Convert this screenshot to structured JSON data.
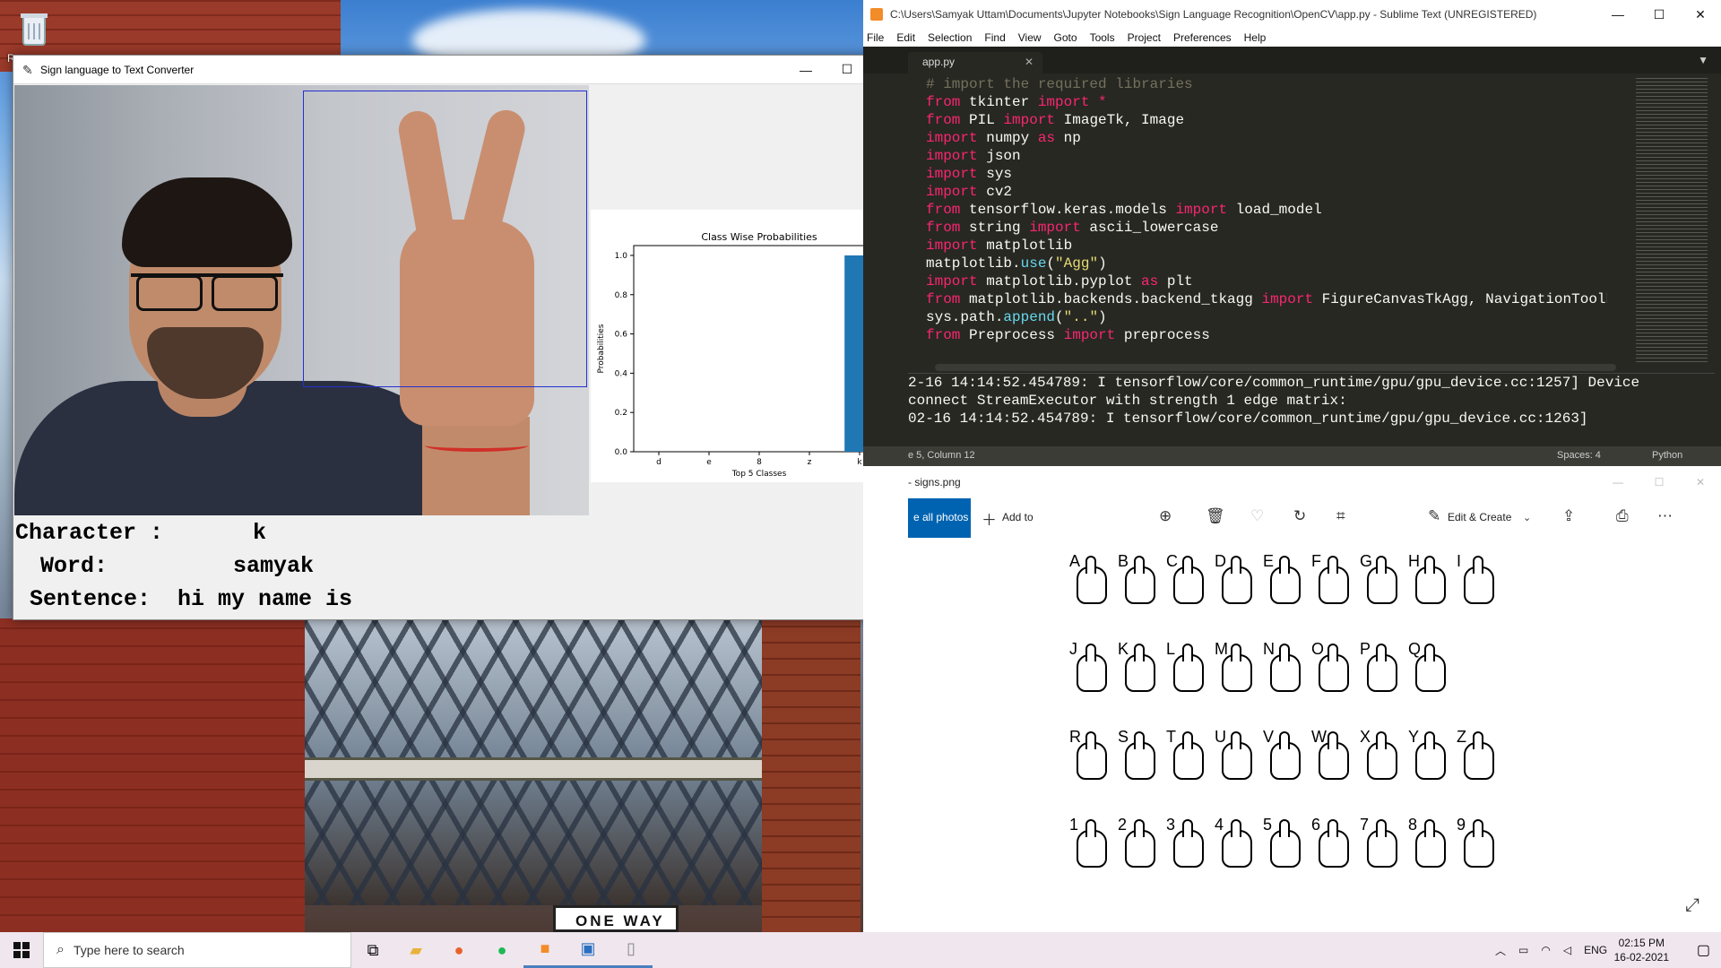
{
  "desktop": {
    "recycle_bin_label": "R",
    "street_sign_text": "ONE WAY"
  },
  "tk_window": {
    "title": "Sign language to Text Converter",
    "minimize": "—",
    "maximize": "☐",
    "close": "✕",
    "character_label": "Character :",
    "character_value": "k",
    "word_label": "Word:",
    "word_value": "samyak",
    "sentence_label": "Sentence:",
    "sentence_value": "hi my name is"
  },
  "chart_data": {
    "type": "bar",
    "title": "Class Wise Probabilities",
    "xlabel": "Top 5 Classes",
    "ylabel": "Probabilities",
    "categories": [
      "d",
      "e",
      "8",
      "z",
      "k"
    ],
    "values": [
      0.0,
      0.0,
      0.0,
      0.0,
      1.0
    ],
    "ylim": [
      0,
      1.05
    ],
    "yticks": [
      "0.0",
      "0.2",
      "0.4",
      "0.6",
      "0.8",
      "1.0"
    ],
    "bar_color": "#1f77b4",
    "grid": false
  },
  "sublime": {
    "title": "C:\\Users\\Samyak Uttam\\Documents\\Jupyter Notebooks\\Sign Language Recognition\\OpenCV\\app.py - Sublime Text (UNREGISTERED)",
    "menu": [
      "File",
      "Edit",
      "Selection",
      "Find",
      "View",
      "Goto",
      "Tools",
      "Project",
      "Preferences",
      "Help"
    ],
    "tab_name": "app.py",
    "console_lines": [
      "2-16 14:14:52.454789: I tensorflow/core/common_runtime/gpu/gpu_device.cc:1257] Device",
      "connect StreamExecutor with strength 1 edge matrix:",
      "02-16 14:14:52.454789: I tensorflow/core/common_runtime/gpu/gpu_device.cc:1263]"
    ],
    "status_left": "e 5, Column 12",
    "status_spaces": "Spaces: 4",
    "status_syntax": "Python"
  },
  "photos": {
    "title": "- signs.png",
    "all_photos": "e all photos",
    "add_to": "Add to",
    "edit_create": "Edit & Create",
    "letters_row1": [
      "A",
      "B",
      "C",
      "D",
      "E",
      "F",
      "G",
      "H",
      "I"
    ],
    "letters_row2": [
      "J",
      "K",
      "L",
      "M",
      "N",
      "O",
      "P",
      "Q"
    ],
    "letters_row3": [
      "R",
      "S",
      "T",
      "U",
      "V",
      "W",
      "X",
      "Y",
      "Z"
    ],
    "letters_row4": [
      "1",
      "2",
      "3",
      "4",
      "5",
      "6",
      "7",
      "8",
      "9"
    ]
  },
  "taskbar": {
    "search_placeholder": "Type here to search",
    "language": "ENG",
    "time": "02:15 PM",
    "date": "16-02-2021"
  }
}
